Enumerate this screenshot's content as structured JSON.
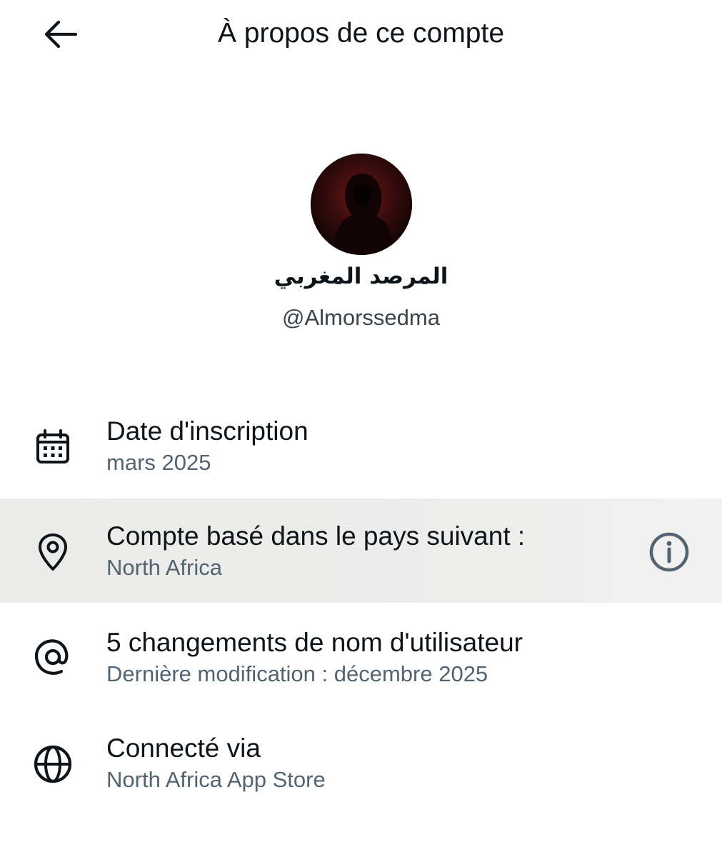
{
  "header": {
    "title": "À propos de ce compte",
    "back_icon": "arrow-left-icon"
  },
  "profile": {
    "display_name": "المرصد المغربي",
    "handle": "@Almorssedma",
    "avatar_description_colors": {
      "background": "#3a0b0b"
    }
  },
  "rows": [
    {
      "icon": "calendar-icon",
      "label": "Date d'inscription",
      "value": "mars 2025"
    },
    {
      "icon": "location-pin-icon",
      "label": "Compte basé dans le pays suivant :",
      "value": "North Africa",
      "info_icon": "info-icon"
    },
    {
      "icon": "at-sign-icon",
      "label": "5 changements de nom d'utilisateur",
      "value": "Dernière modification : décembre 2025"
    },
    {
      "icon": "globe-icon",
      "label": "Connecté via",
      "value": "North Africa App Store"
    }
  ],
  "colors": {
    "primary_text": "#0f1419",
    "secondary_text": "#536471",
    "highlight_row": "#ebebea"
  }
}
